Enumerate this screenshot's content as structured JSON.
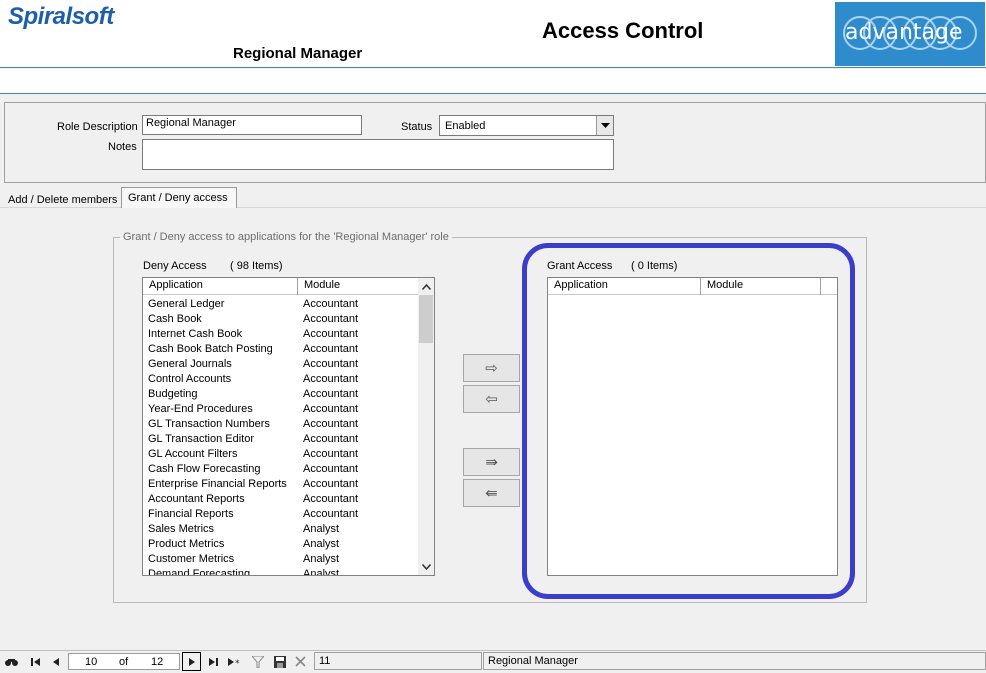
{
  "header": {
    "logo_text": "Spiralsoft",
    "title": "Access Control",
    "subtitle": "Regional Manager",
    "badge_text": "advantage"
  },
  "form": {
    "role_label": "Role Description",
    "role_value": "Regional Manager",
    "status_label": "Status",
    "status_value": "Enabled",
    "notes_label": "Notes",
    "notes_value": ""
  },
  "tabs": [
    {
      "label": "Add / Delete members",
      "active": false
    },
    {
      "label": "Grant / Deny access",
      "active": true
    }
  ],
  "group": {
    "legend": "Grant / Deny access to applications for the 'Regional Manager' role"
  },
  "deny": {
    "title": "Deny Access",
    "count": "( 98 Items)",
    "columns": [
      "Application",
      "Module"
    ],
    "rows": [
      [
        "General Ledger",
        "Accountant"
      ],
      [
        "Cash Book",
        "Accountant"
      ],
      [
        "Internet Cash Book",
        "Accountant"
      ],
      [
        "Cash Book Batch Posting",
        "Accountant"
      ],
      [
        "General Journals",
        "Accountant"
      ],
      [
        "Control Accounts",
        "Accountant"
      ],
      [
        "Budgeting",
        "Accountant"
      ],
      [
        "Year-End Procedures",
        "Accountant"
      ],
      [
        "GL Transaction Numbers",
        "Accountant"
      ],
      [
        "GL Transaction Editor",
        "Accountant"
      ],
      [
        "GL Account Filters",
        "Accountant"
      ],
      [
        "Cash Flow Forecasting",
        "Accountant"
      ],
      [
        "Enterprise Financial Reports",
        "Accountant"
      ],
      [
        "Accountant Reports",
        "Accountant"
      ],
      [
        "Financial Reports",
        "Accountant"
      ],
      [
        "Sales Metrics",
        "Analyst"
      ],
      [
        "Product Metrics",
        "Analyst"
      ],
      [
        "Customer Metrics",
        "Analyst"
      ],
      [
        "Demand Forecasting",
        "Analyst"
      ]
    ]
  },
  "grant": {
    "title": "Grant Access",
    "count": "( 0 Items)",
    "columns": [
      "Application",
      "Module"
    ],
    "rows": []
  },
  "buttons": {
    "move_right": "⇨",
    "move_left": "⇦",
    "move_all_right": "⇛",
    "move_all_left": "⇚"
  },
  "navbar": {
    "current": "10",
    "of_label": "of",
    "total": "12",
    "record_id": "11",
    "record_name": "Regional Manager"
  },
  "colors": {
    "highlight": "#3a3ec8",
    "brand": "#1f5fa8",
    "badge": "#2f8ccc"
  }
}
